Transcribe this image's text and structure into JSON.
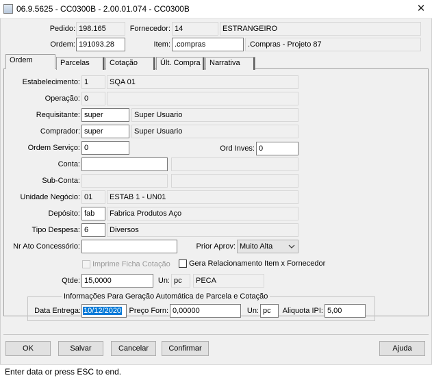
{
  "window": {
    "title": "06.9.5625 - CC0300B - 2.00.01.074 - CC0300B",
    "close_label": "✕"
  },
  "header": {
    "pedido_label": "Pedido:",
    "pedido_value": "198.165",
    "fornecedor_label": "Fornecedor:",
    "fornecedor_code": "14",
    "fornecedor_name": "ESTRANGEIRO",
    "ordem_label": "Ordem:",
    "ordem_value": "191093.28",
    "item_label": "Item:",
    "item_code": ".compras",
    "item_desc": ".Compras - Projeto 87"
  },
  "tabs": [
    {
      "label": "Ordem",
      "active": true
    },
    {
      "label": "Parcelas",
      "active": false
    },
    {
      "label": "Cotação",
      "active": false
    },
    {
      "label": "Últ. Compra",
      "active": false
    },
    {
      "label": "Narrativa",
      "active": false
    }
  ],
  "form": {
    "estabelecimento": {
      "label": "Estabelecimento:",
      "code": "1",
      "desc": "SQA 01"
    },
    "operacao": {
      "label": "Operação:",
      "code": "0",
      "desc": ""
    },
    "requisitante": {
      "label": "Requisitante:",
      "code": "super",
      "desc": "Super Usuario"
    },
    "comprador": {
      "label": "Comprador:",
      "code": "super",
      "desc": "Super Usuario"
    },
    "ordem_servico": {
      "label": "Ordem Serviço:",
      "value": "0"
    },
    "ord_inves": {
      "label": "Ord Inves:",
      "value": "0"
    },
    "conta": {
      "label": "Conta:",
      "value": "",
      "desc": ""
    },
    "sub_conta": {
      "label": "Sub-Conta:",
      "value": "",
      "desc": ""
    },
    "unidade_negocio": {
      "label": "Unidade Negócio:",
      "code": "01",
      "desc": "ESTAB 1 - UN01"
    },
    "deposito": {
      "label": "Depósito:",
      "code": "fab",
      "desc": "Fabrica Produtos Aço"
    },
    "tipo_despesa": {
      "label": "Tipo Despesa:",
      "code": "6",
      "desc": "Diversos"
    },
    "nr_ato": {
      "label": "Nr Ato Concessório:",
      "value": ""
    },
    "prior_aprov": {
      "label": "Prior Aprov:",
      "selected": "Muito Alta"
    },
    "imprime_ficha": {
      "label": "Imprime Ficha Cotação",
      "checked": false,
      "enabled": false
    },
    "gera_relacionamento": {
      "label": "Gera Relacionamento Item x Fornecedor",
      "checked": false,
      "enabled": true
    },
    "qtde": {
      "label": "Qtde:",
      "value": "15,0000"
    },
    "un": {
      "label": "Un:",
      "code": "pc",
      "desc": "PECA"
    }
  },
  "parcela_group": {
    "title": "Informações Para Geração Automática de Parcela e Cotação",
    "data_entrega_label": "Data Entrega:",
    "data_entrega_value": "10/12/2020",
    "preco_label": "Preço Forn:",
    "preco_value": "0,00000",
    "un_label": "Un:",
    "un_value": "pc",
    "aliquota_label": "Aliquota IPI:",
    "aliquota_value": "5,00"
  },
  "buttons": {
    "ok": "OK",
    "salvar": "Salvar",
    "cancelar": "Cancelar",
    "confirmar": "Confirmar",
    "ajuda": "Ajuda"
  },
  "status": {
    "text": "Enter data or press ESC to end."
  },
  "colors": {
    "selection": "#0078d7",
    "dialog_bg": "#f0f0f0"
  }
}
